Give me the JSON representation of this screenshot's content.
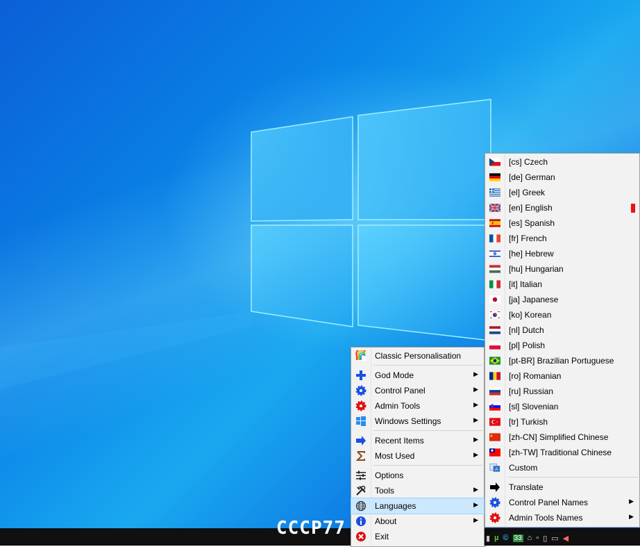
{
  "taskbar": {
    "clock_text": "CCCP77",
    "tray_badge": "33"
  },
  "main_menu": {
    "items": [
      {
        "label": "Classic Personalisation",
        "icon": "rainbow-icon",
        "submenu": false
      },
      {
        "sep": true
      },
      {
        "label": "God Mode",
        "icon": "blue-plus-icon",
        "submenu": true
      },
      {
        "label": "Control Panel",
        "icon": "blue-gear-icon",
        "submenu": true
      },
      {
        "label": "Admin Tools",
        "icon": "red-gear-icon",
        "submenu": true
      },
      {
        "label": "Windows Settings",
        "icon": "windows-logo-icon",
        "submenu": true
      },
      {
        "sep": true
      },
      {
        "label": "Recent Items",
        "icon": "blue-arrow-icon",
        "submenu": true
      },
      {
        "label": "Most Used",
        "icon": "sigma-icon",
        "submenu": true
      },
      {
        "sep": true
      },
      {
        "label": "Options",
        "icon": "sliders-icon",
        "submenu": false
      },
      {
        "label": "Tools",
        "icon": "tools-icon",
        "submenu": true
      },
      {
        "label": "Languages",
        "icon": "globe-icon",
        "submenu": true,
        "highlighted": true
      },
      {
        "label": "About",
        "icon": "info-icon",
        "submenu": true
      },
      {
        "label": "Exit",
        "icon": "exit-icon",
        "submenu": false
      }
    ]
  },
  "lang_menu": {
    "items": [
      {
        "label": "[cs] Czech",
        "flag": "cz"
      },
      {
        "label": "[de] German",
        "flag": "de"
      },
      {
        "label": "[el] Greek",
        "flag": "gr"
      },
      {
        "label": "[en] English",
        "flag": "gb",
        "active": true
      },
      {
        "label": "[es] Spanish",
        "flag": "es"
      },
      {
        "label": "[fr] French",
        "flag": "fr"
      },
      {
        "label": "[he] Hebrew",
        "flag": "il"
      },
      {
        "label": "[hu] Hungarian",
        "flag": "hu"
      },
      {
        "label": "[it] Italian",
        "flag": "it"
      },
      {
        "label": "[ja] Japanese",
        "flag": "jp"
      },
      {
        "label": "[ko] Korean",
        "flag": "kr"
      },
      {
        "label": "[nl] Dutch",
        "flag": "nl"
      },
      {
        "label": "[pl] Polish",
        "flag": "pl"
      },
      {
        "label": "[pt-BR] Brazilian Portuguese",
        "flag": "br"
      },
      {
        "label": "[ro] Romanian",
        "flag": "ro"
      },
      {
        "label": "[ru] Russian",
        "flag": "ru"
      },
      {
        "label": "[sl] Slovenian",
        "flag": "si"
      },
      {
        "label": "[tr] Turkish",
        "flag": "tr"
      },
      {
        "label": "[zh-CN] Simplified Chinese",
        "flag": "cn"
      },
      {
        "label": "[zh-TW] Traditional Chinese",
        "flag": "tw"
      },
      {
        "label": "Custom",
        "flag": "custom"
      },
      {
        "sep": true
      },
      {
        "label": "Translate",
        "icon": "black-arrow-icon",
        "submenu": false
      },
      {
        "label": "Control Panel Names",
        "icon": "blue-gear-icon",
        "submenu": true
      },
      {
        "label": "Admin Tools Names",
        "icon": "red-gear-icon",
        "submenu": true
      }
    ]
  },
  "colors": {
    "highlight_bg": "#cce8ff",
    "active_marker": "#ee1111",
    "menu_bg": "#f2f2f2"
  }
}
